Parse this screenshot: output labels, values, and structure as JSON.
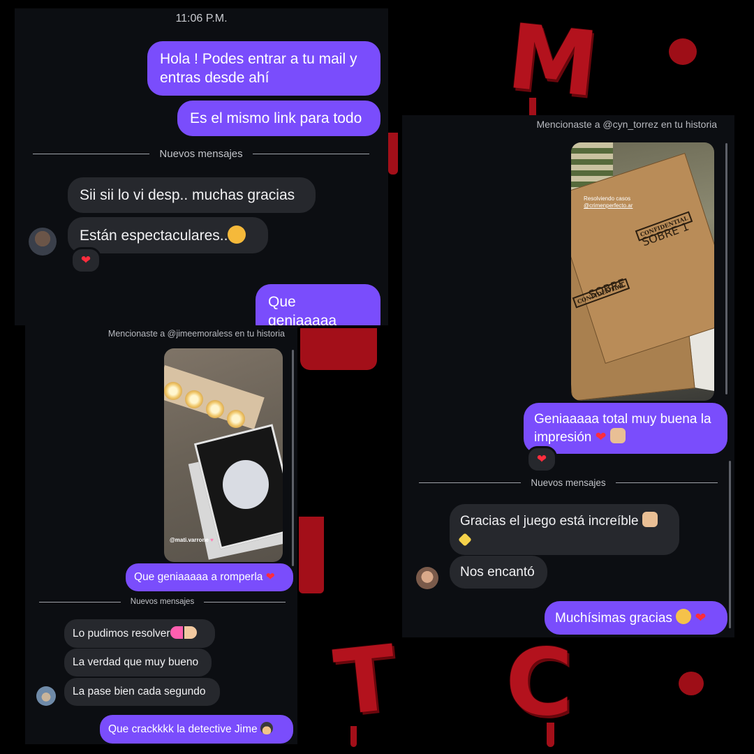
{
  "background": {
    "letters": [
      "M",
      "T",
      "C"
    ],
    "color": "#b3121d"
  },
  "colors": {
    "outgoing": "#7a4dfc",
    "incoming": "#26282d",
    "panel": "#0c0e12",
    "reaction": "#ff2d3d"
  },
  "panel1": {
    "time": "11:06 P.M.",
    "out1": "Hola ! Podes entrar a tu mail y entras desde ahí",
    "out2": "Es el mismo link para todo",
    "divider": "Nuevos mensajes",
    "in1": "Sii sii lo vi desp.. muchas gracias",
    "in2": "Están espectaculares..",
    "in2_emoji": "hugging-face-emoji",
    "reaction": "❤",
    "out3": "Que geniaaaaa"
  },
  "panel2": {
    "mention": "Mencionaste a @jimeemoraless en tu historia",
    "story_caption": "@mati.varrone",
    "out1": "Que geniaaaaa a romperla",
    "out1_heart": "❤",
    "divider": "Nuevos mensajes",
    "in1": "Lo pudimos resolver",
    "in1_emoji": "pink-heart-and-thumbs-up-emoji",
    "in2": "La verdad que muy bueno",
    "in3": "La pase bien cada segundo",
    "out2": "Que crackkkk la detective Jime",
    "out2_emoji": "detective-emoji"
  },
  "panel3": {
    "mention": "Mencionaste a @cyn_torrez en tu historia",
    "story_caption_1": "Resolviendo casos",
    "story_caption_2": "@crimenperfecto.ar",
    "envelope_stamp": "CONFIDENTIAL",
    "envelope_1": "SOBRE 1",
    "envelope_2": "SOBRE",
    "out1": "Geniaaaaa total muy buena la impresión",
    "out1_heart": "❤",
    "reaction": "❤",
    "divider": "Nuevos mensajes",
    "in1": "Gracias el juego está increíble",
    "in2": "Nos encantó",
    "out2": "Muchísimas gracias",
    "out2_heart": "❤"
  }
}
